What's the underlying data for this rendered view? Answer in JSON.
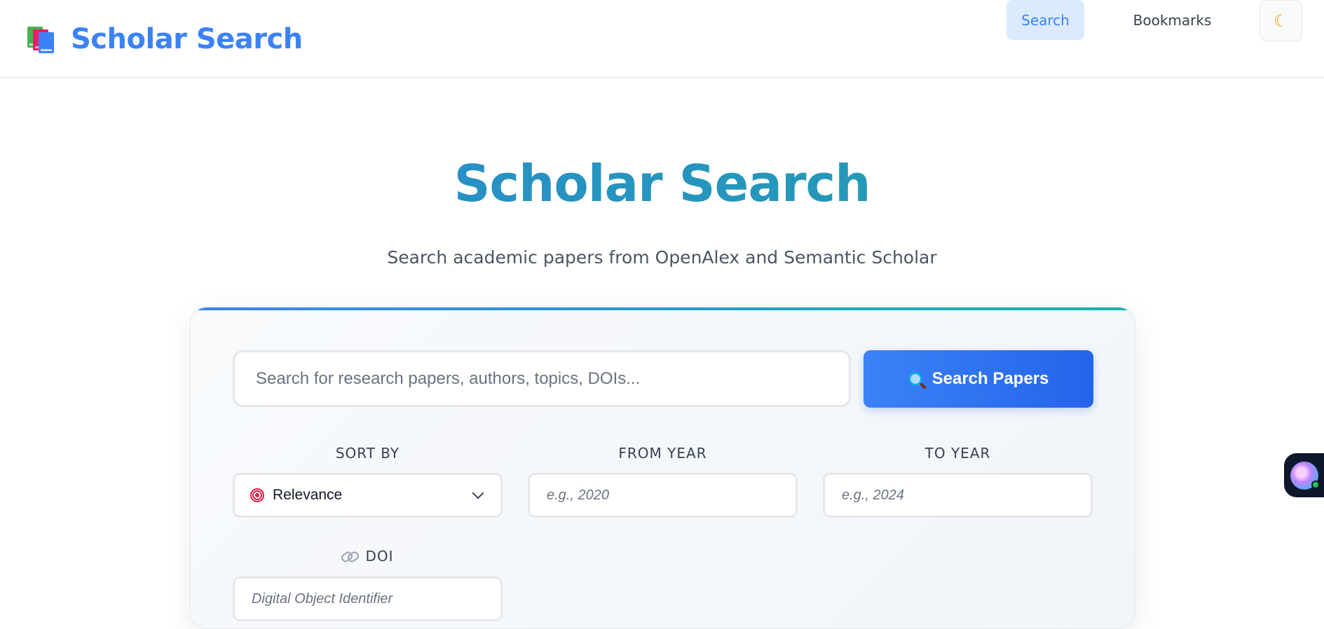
{
  "app": {
    "brand_title": "Scholar Search",
    "brand_icon": "books-icon"
  },
  "nav": {
    "search_label": "Search",
    "bookmarks_label": "Bookmarks",
    "theme_icon": "moon-icon"
  },
  "hero": {
    "title": "Scholar Search",
    "subtitle": "Search academic papers from OpenAlex and Semantic Scholar"
  },
  "search": {
    "placeholder": "Search for research papers, authors, topics, DOIs...",
    "value": "",
    "button_label": "Search Papers",
    "button_icon": "magnifier-icon"
  },
  "filters": {
    "sort_label": "SORT BY",
    "sort_value": "Relevance",
    "sort_icon": "target-icon",
    "from_label": "FROM YEAR",
    "from_placeholder": "e.g., 2020",
    "to_label": "TO YEAR",
    "to_placeholder": "e.g., 2024",
    "doi_label": "DOI",
    "doi_icon": "link-icon",
    "doi_placeholder": "Digital Object Identifier"
  },
  "colors": {
    "accent": "#3b82f6",
    "accent_dark": "#2563eb",
    "teal": "#14b8a6",
    "nav_active_bg": "#dbeafe"
  }
}
